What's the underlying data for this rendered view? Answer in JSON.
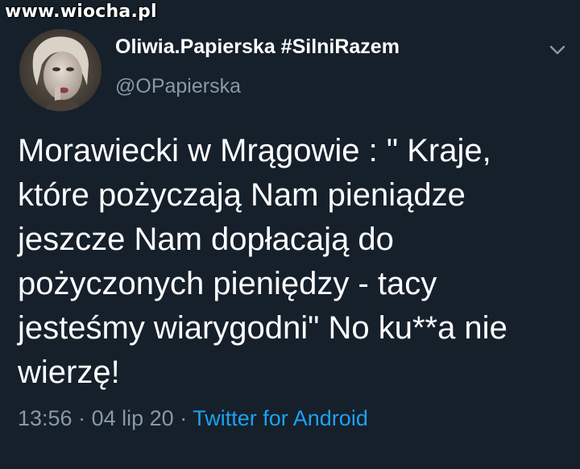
{
  "watermark": "www.wiocha.pl",
  "tweet": {
    "display_name": "Oliwia.Papierska #SilniRazem",
    "handle": "@OPapierska",
    "text": "Morawiecki w Mrągowie : \" Kraje,\nktóre pożyczają Nam pieniądze\njeszcze Nam dopłacają do\npożyczonych pieniędzy - tacy\njesteśmy wiarygodni\" No ku**a nie\nwierzę!",
    "time": "13:56",
    "separator": "·",
    "date": "04 lip 20",
    "source": "Twitter for Android"
  },
  "icons": {
    "menu": "chevron-down-icon"
  },
  "colors": {
    "background": "#15202b",
    "primary_text": "#ffffff",
    "secondary_text": "#8899a6",
    "link": "#1da1f2"
  }
}
